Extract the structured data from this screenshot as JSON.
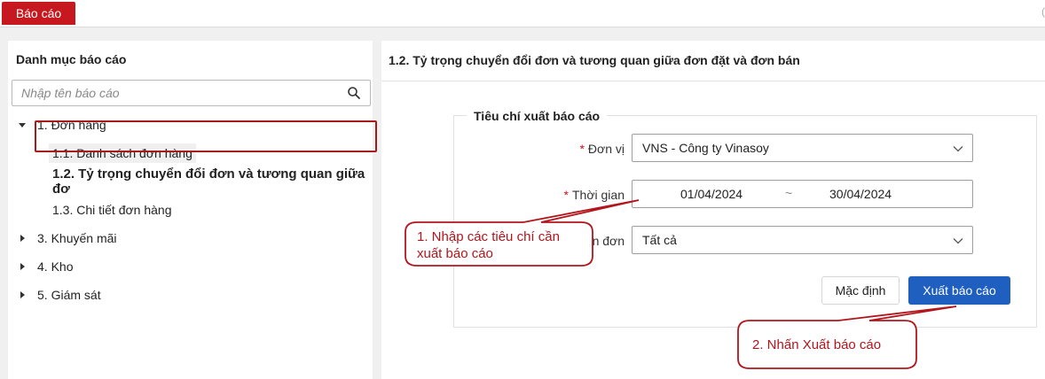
{
  "topbar": {
    "active_tab": "Báo cáo"
  },
  "left_panel": {
    "title": "Danh mục báo cáo",
    "search_placeholder": "Nhập tên báo cáo",
    "tree": {
      "group1": "1. Đơn hàng",
      "item_1_1": "1.1. Danh sách đơn hàng",
      "item_1_2": "1.2. Tỷ trọng chuyển đổi đơn và tương quan giữa đơ",
      "item_1_3": "1.3. Chi tiết đơn hàng",
      "group3": "3. Khuyến mãi",
      "group4": "4. Kho",
      "group5": "5. Giám sát"
    }
  },
  "report": {
    "title": "1.2. Tỷ trọng chuyển đổi đơn và tương quan giữa đơn đặt và đơn bán",
    "criteria_legend": "Tiêu chí xuất báo cáo",
    "unit_label": "Đơn vị",
    "unit_value": "VNS - Công ty Vinasoy",
    "time_label": "Thời gian",
    "date_from": "01/04/2024",
    "date_sep": "~",
    "date_to": "30/04/2024",
    "order_label_partial": "n đơn",
    "order_value": "Tất cả",
    "default_button": "Mặc định",
    "export_button": "Xuất báo cáo"
  },
  "callouts": {
    "callout1_line1": "1. Nhập các tiêu chí cần",
    "callout1_line2": "xuất báo cáo",
    "callout2": "2. Nhấn Xuất báo cáo",
    "color": "#b2161c"
  }
}
